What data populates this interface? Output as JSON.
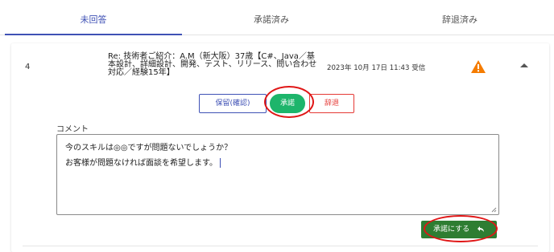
{
  "tabs": {
    "unanswered": "未回答",
    "accepted": "承諾済み",
    "declined": "辞退済み"
  },
  "item": {
    "number": "4",
    "subject": "Re: 技術者ご紹介：A.M（新大阪）37歳【C#、Java／基本設計、詳細設計、開発、テスト、リリース、問い合わせ対応／経験15年】",
    "received": "2023年 10月 17日 11:43 受信",
    "warning_icon": "warning-icon",
    "collapse_icon": "chevron-up-icon"
  },
  "actions": {
    "hold_label": "保留(確認)",
    "accept_label": "承諾",
    "decline_label": "辞退"
  },
  "comment": {
    "label": "コメント",
    "line1": "今のスキルは◎◎ですが問題ないでしょうか？",
    "line2": "お客様が問題なければ面談を希望します。"
  },
  "submit": {
    "label": "承諾にする",
    "icon": "reply-icon"
  },
  "colors": {
    "primary": "#3f51b5",
    "accept": "#1db56b",
    "decline": "#e53935",
    "submit": "#2e7d32",
    "warning": "#f57c00",
    "annotation": "#e01616"
  }
}
